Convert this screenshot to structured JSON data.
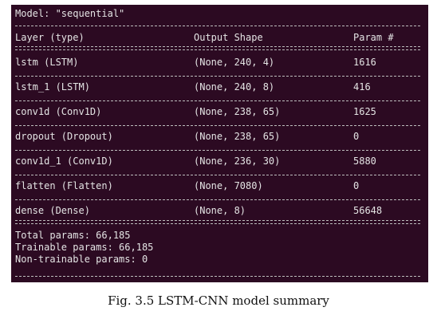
{
  "model": {
    "title_line": "Model: \"sequential\""
  },
  "table": {
    "headers": {
      "layer": "Layer (type)",
      "output": "Output Shape",
      "params": "Param #"
    },
    "rows": [
      {
        "layer": "lstm (LSTM)",
        "output": "(None, 240, 4)",
        "params": "1616"
      },
      {
        "layer": "lstm_1 (LSTM)",
        "output": "(None, 240, 8)",
        "params": "416"
      },
      {
        "layer": "conv1d (Conv1D)",
        "output": "(None, 238, 65)",
        "params": "1625"
      },
      {
        "layer": "dropout (Dropout)",
        "output": "(None, 238, 65)",
        "params": "0"
      },
      {
        "layer": "conv1d_1 (Conv1D)",
        "output": "(None, 236, 30)",
        "params": "5880"
      },
      {
        "layer": "flatten (Flatten)",
        "output": "(None, 7080)",
        "params": "0"
      },
      {
        "layer": "dense (Dense)",
        "output": "(None, 8)",
        "params": "56648"
      }
    ]
  },
  "summary": {
    "total": "Total params: 66,185",
    "trainable": "Trainable params: 66,185",
    "non_trainable": "Non-trainable params: 0"
  },
  "caption": "Fig. 3.5 LSTM-CNN model summary"
}
